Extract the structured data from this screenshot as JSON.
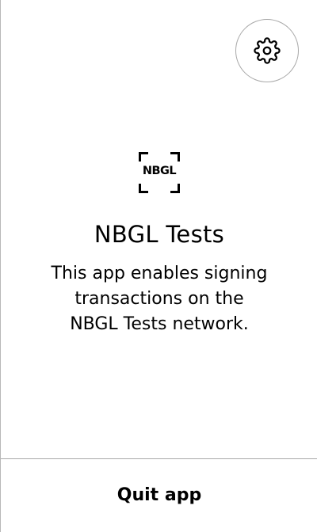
{
  "settings": {
    "icon": "gear-icon"
  },
  "app": {
    "icon": {
      "name": "nbgl-app-icon",
      "text": "NBGL"
    },
    "title": "NBGL Tests",
    "description_lines": [
      "This app enables signing",
      "transactions on the",
      "NBGL Tests network."
    ]
  },
  "footer": {
    "quit_label": "Quit app"
  }
}
